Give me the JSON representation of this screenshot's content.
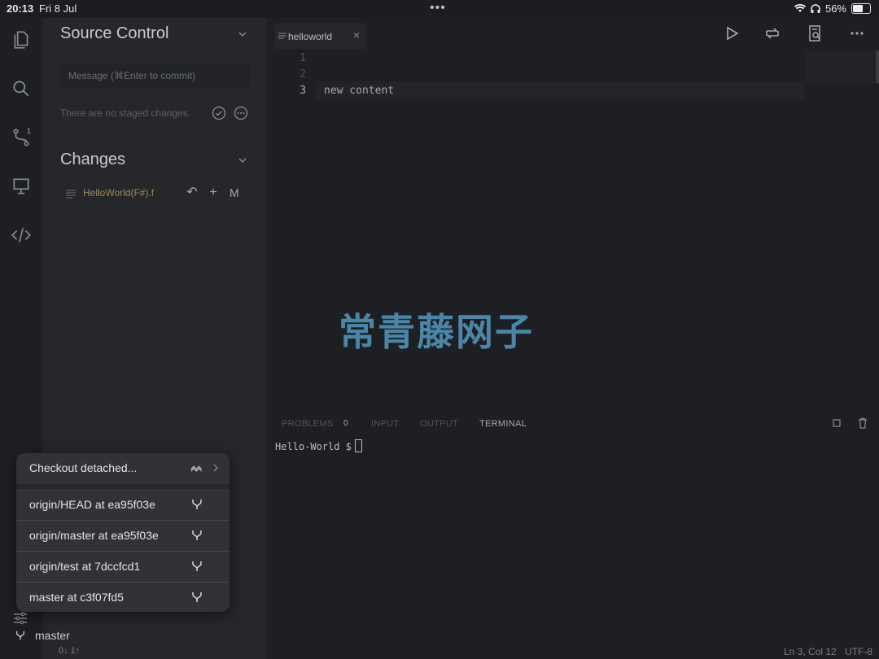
{
  "status_bar": {
    "time": "20:13",
    "date": "Fri 8 Jul",
    "battery": "56%"
  },
  "activity_bar": {
    "items": [
      {
        "icon": "files-icon"
      },
      {
        "icon": "search-icon"
      },
      {
        "icon": "source-control-icon",
        "badge": "1"
      },
      {
        "icon": "remote-icon"
      },
      {
        "icon": "code-icon"
      }
    ]
  },
  "sidebar": {
    "source_control_title": "Source Control",
    "commit_placeholder": "Message (⌘Enter to commit)",
    "no_staged": "There are no staged changes.",
    "changes_title": "Changes",
    "changes": [
      {
        "filename": "HelloWorld(F#).f",
        "status": "M"
      }
    ]
  },
  "editor": {
    "tab_label": "helloworld",
    "line_numbers": [
      "1",
      "2",
      "3"
    ],
    "lines": [
      "",
      "",
      "new content"
    ]
  },
  "panel": {
    "tabs": [
      "PROBLEMS",
      "INPUT",
      "OUTPUT",
      "TERMINAL"
    ],
    "problems_count": "0",
    "active_tab": "TERMINAL",
    "terminal_prompt": "Hello-World $"
  },
  "watermark": "常青藤网子",
  "checkout_popup": {
    "header": "Checkout detached...",
    "refs": [
      "origin/HEAD at ea95f03e",
      "origin/master at ea95f03e",
      "origin/test at 7dccfcd1",
      "master at c3f07fd5"
    ]
  },
  "bottom": {
    "branch": "master",
    "sync": "0↓ 1↑",
    "position": "Ln 3, Col 12",
    "encoding": "UTF-8"
  },
  "colors": {
    "accent_watermark": "#4a86a8",
    "file_modified": "#9c8b58"
  }
}
